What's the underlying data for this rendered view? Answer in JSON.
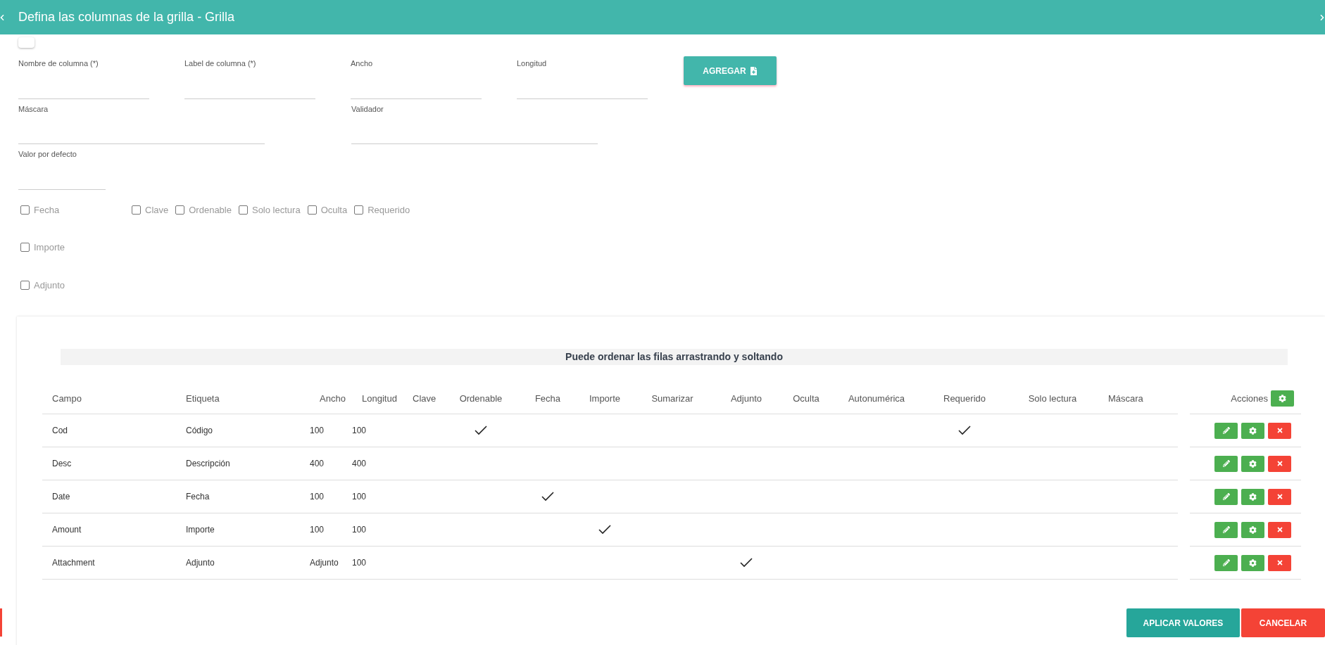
{
  "dialog": {
    "title": "Defina las columnas de la grilla - Grilla"
  },
  "toggle": {
    "on": false
  },
  "fields": [
    {
      "label": "Nombre de columna (*)"
    },
    {
      "label": "Label de columna (*)"
    },
    {
      "label": "Ancho"
    },
    {
      "label": "Longitud"
    },
    {
      "label": "Máscara"
    },
    {
      "label": "Validador"
    },
    {
      "label": "Valor por defecto"
    }
  ],
  "add_button": "AGREGAR",
  "checkbox_groups": [
    [
      {
        "label": "Fecha",
        "checked": false
      }
    ],
    [
      {
        "label": "Clave",
        "checked": false
      },
      {
        "label": "Ordenable",
        "checked": false
      },
      {
        "label": "Solo lectura",
        "checked": false
      },
      {
        "label": "Oculta",
        "checked": false
      },
      {
        "label": "Requerido",
        "checked": false
      }
    ],
    [
      {
        "label": "Importe",
        "checked": false
      }
    ],
    [
      {
        "label": "Adjunto",
        "checked": false
      }
    ]
  ],
  "table": {
    "banner": "Puede ordenar las filas arrastrando y soltando",
    "columns": [
      {
        "label": "Campo",
        "kind": "text"
      },
      {
        "label": "Etiqueta",
        "kind": "text"
      },
      {
        "label": "Ancho",
        "kind": "text"
      },
      {
        "label": "Longitud",
        "kind": "text"
      },
      {
        "label": "Clave",
        "kind": "check"
      },
      {
        "label": "Ordenable",
        "kind": "check"
      },
      {
        "label": "Fecha",
        "kind": "check"
      },
      {
        "label": "Importe",
        "kind": "check"
      },
      {
        "label": "Sumarizar",
        "kind": "check"
      },
      {
        "label": "Adjunto",
        "kind": "check"
      },
      {
        "label": "Oculta",
        "kind": "check"
      },
      {
        "label": "Autonumérica",
        "kind": "check"
      },
      {
        "label": "Requerido",
        "kind": "check"
      },
      {
        "label": "Solo lectura",
        "kind": "check"
      },
      {
        "label": "Máscara",
        "kind": "text"
      }
    ],
    "actions_label": "Acciones",
    "rows": [
      {
        "text": [
          "Cod",
          "Código",
          "100",
          "100"
        ],
        "checks": [
          false,
          true,
          false,
          false,
          false,
          false,
          false,
          false,
          true,
          false
        ]
      },
      {
        "text": [
          "Desc",
          "Descripción",
          "400",
          "400"
        ],
        "checks": [
          false,
          false,
          false,
          false,
          false,
          false,
          false,
          false,
          false,
          false
        ]
      },
      {
        "text": [
          "Date",
          "Fecha",
          "100",
          "100"
        ],
        "checks": [
          false,
          false,
          true,
          false,
          false,
          false,
          false,
          false,
          false,
          false
        ]
      },
      {
        "text": [
          "Amount",
          "Importe",
          "100",
          "100"
        ],
        "checks": [
          false,
          false,
          false,
          true,
          false,
          false,
          false,
          false,
          false,
          false
        ]
      },
      {
        "text": [
          "Attachment",
          "Adjunto",
          "Adjunto",
          "100"
        ],
        "checks": [
          false,
          false,
          false,
          false,
          false,
          true,
          false,
          false,
          false,
          false
        ]
      }
    ]
  },
  "footer_buttons": [
    {
      "label": "APLICAR VALORES",
      "kind": "primary"
    },
    {
      "label": "CANCELAR",
      "kind": "danger"
    }
  ]
}
